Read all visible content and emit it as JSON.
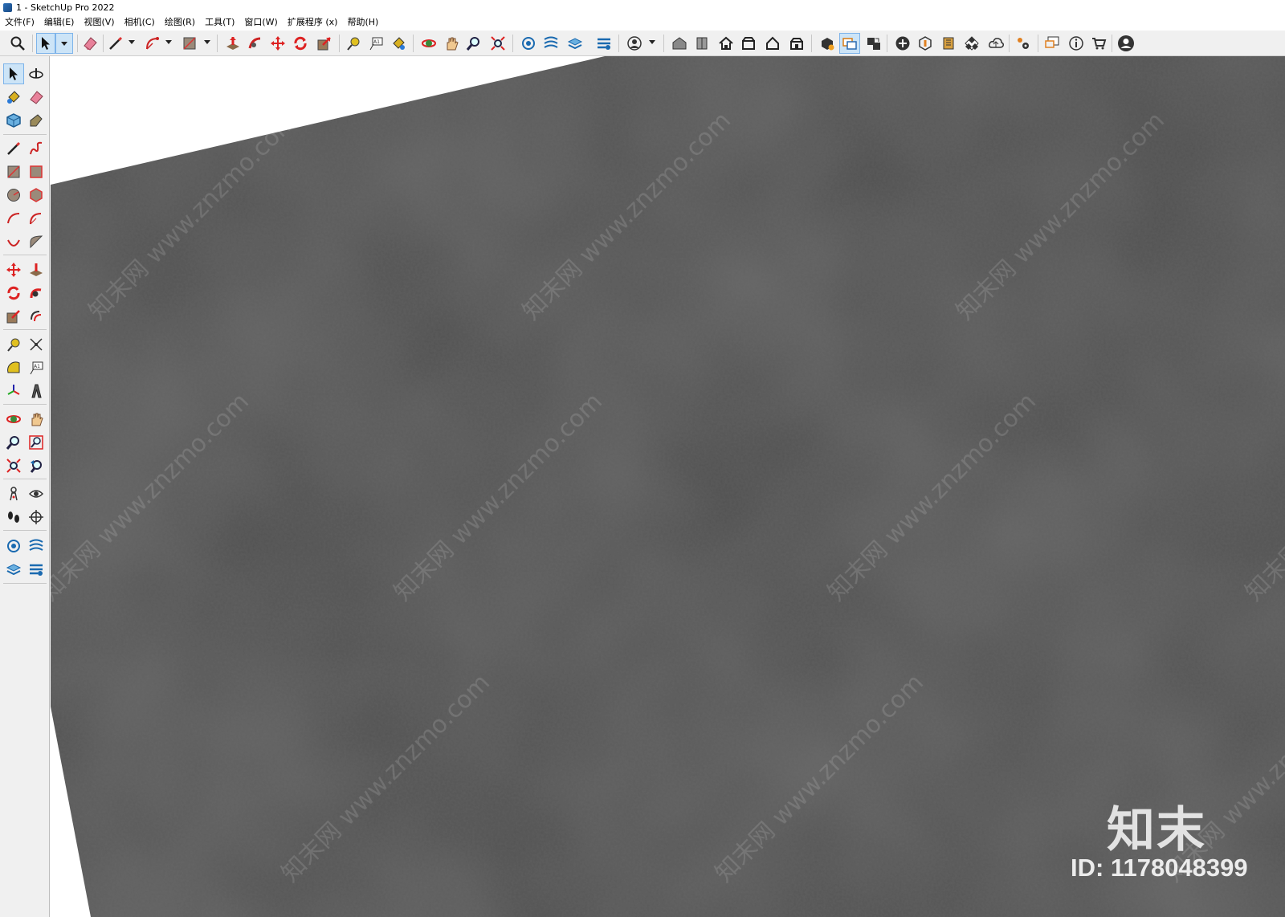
{
  "window": {
    "title": "1 - SketchUp Pro 2022"
  },
  "menu": [
    "文件(F)",
    "编辑(E)",
    "视图(V)",
    "相机(C)",
    "绘图(R)",
    "工具(T)",
    "窗口(W)",
    "扩展程序 (x)",
    "帮助(H)"
  ],
  "top_toolbar": {
    "icons": [
      "search-icon",
      "select-icon",
      "eraser-icon",
      "pencil-icon",
      "arc-icon",
      "rectangle-icon",
      "push-pull-icon",
      "follow-me-icon",
      "move-icon",
      "rotate-icon",
      "scale-icon",
      "tape-measure-icon",
      "text-icon",
      "paint-bucket-icon",
      "orbit-icon",
      "pan-icon",
      "zoom-icon",
      "zoom-extents-icon",
      "layer-tags-icon",
      "scenes-icon",
      "styles-icon",
      "outliner-icon",
      "user-icon",
      "warehouse-icon",
      "component-icon",
      "home-icon",
      "front-view-icon",
      "house-outline-icon",
      "back-view-icon",
      "solid-tools-icon",
      "section-plane-icon",
      "section-display-icon",
      "add-icon",
      "sandbox-icon",
      "texture-icon",
      "checker-icon",
      "cloud-icon",
      "settings-icon",
      "message-icon",
      "info-icon",
      "cart-icon",
      "account-icon"
    ]
  },
  "left_toolbar": {
    "icons": [
      "select-icon",
      "orbit-icon",
      "paint-bucket-icon",
      "eraser-icon",
      "make-component-icon",
      "tag-icon",
      "pencil-icon",
      "freehand-icon",
      "rectangle-icon",
      "rotated-rectangle-icon",
      "circle-icon",
      "polygon-icon",
      "arc-icon",
      "two-point-arc-icon",
      "three-point-arc-icon",
      "pie-icon",
      "move-icon",
      "push-pull-icon",
      "rotate-icon",
      "follow-me-icon",
      "scale-icon",
      "offset-icon",
      "tape-measure-icon",
      "dimension-icon",
      "protractor-icon",
      "text-icon",
      "axes-icon",
      "3d-text-icon",
      "orbit-tool-icon",
      "pan-icon",
      "zoom-icon",
      "zoom-window-icon",
      "zoom-extents-icon",
      "previous-view-icon",
      "position-camera-icon",
      "look-around-icon",
      "walk-icon",
      "section-plane-icon",
      "layers-icon",
      "scenes-icon",
      "styles-icon",
      "outliner-icon"
    ]
  },
  "viewport": {
    "surface_color": "#4a4a4a",
    "watermark_text": "知末网 www.znzmo.com",
    "logo_text": "知末",
    "id_text": "ID: 1178048399"
  }
}
